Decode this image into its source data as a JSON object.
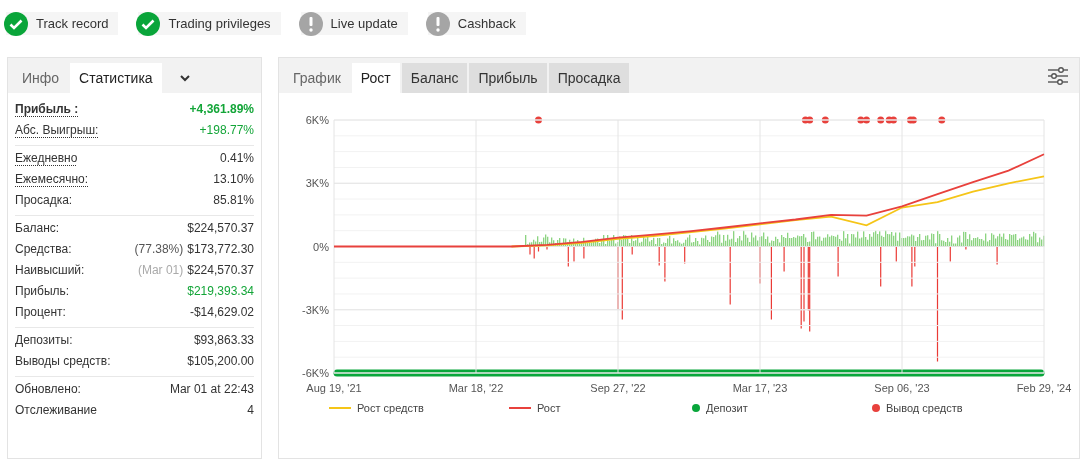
{
  "badges": [
    {
      "label": "Track record",
      "kind": "ok"
    },
    {
      "label": "Trading privileges",
      "kind": "ok"
    },
    {
      "label": "Live update",
      "kind": "warn"
    },
    {
      "label": "Cashback",
      "kind": "warn"
    }
  ],
  "stats_panel": {
    "tabs": [
      {
        "label": "Инфо",
        "selected": false
      },
      {
        "label": "Статистика",
        "selected": true
      }
    ],
    "groups": [
      [
        {
          "label": "Прибыль :",
          "value": "+4,361.89%",
          "positive": true,
          "dotted": true,
          "emphasis": true
        },
        {
          "label": "Абс. Выигрыш:",
          "value": "+198.77%",
          "positive": true,
          "dotted": true,
          "emphasis": false
        }
      ],
      [
        {
          "label": "Ежедневно",
          "value": "0.41%",
          "positive": false,
          "dotted": true,
          "emphasis": false
        },
        {
          "label": "Ежемесячно:",
          "value": "13.10%",
          "positive": false,
          "dotted": true,
          "emphasis": false
        },
        {
          "label": "Просадка:",
          "value": "85.81%",
          "positive": false,
          "dotted": false,
          "emphasis": false
        }
      ],
      [
        {
          "label": "Баланс:",
          "value": "$224,570.37",
          "positive": false,
          "dotted": false,
          "emphasis": false
        },
        {
          "label": "Средства:",
          "note": "(77.38%)",
          "faded": false,
          "value": "$173,772.30",
          "positive": false,
          "dotted": false,
          "emphasis": false
        },
        {
          "label": "Наивысший:",
          "note": "(Mar 01)",
          "faded": true,
          "value": "$224,570.37",
          "positive": false,
          "dotted": false,
          "emphasis": false
        },
        {
          "label": "Прибыль:",
          "value": "$219,393.34",
          "positive": true,
          "dotted": false,
          "emphasis": false
        },
        {
          "label": "Процент:",
          "value": "-$14,629.02",
          "positive": false,
          "dotted": false,
          "emphasis": false
        }
      ],
      [
        {
          "label": "Депозиты:",
          "value": "$93,863.33",
          "positive": false,
          "dotted": false,
          "emphasis": false
        },
        {
          "label": "Выводы средств:",
          "value": "$105,200.00",
          "positive": false,
          "dotted": false,
          "emphasis": false
        }
      ],
      [
        {
          "label": "Обновлено:",
          "value": "Mar 01 at 22:43",
          "positive": false,
          "dotted": false,
          "emphasis": false
        },
        {
          "label": "Отслеживание",
          "value": "4",
          "positive": false,
          "dotted": false,
          "emphasis": false
        }
      ]
    ]
  },
  "chart_panel": {
    "tabs": [
      {
        "label": "График",
        "selected": false,
        "kind": "plain"
      },
      {
        "label": "Рост",
        "selected": true,
        "kind": "plain"
      },
      {
        "label": "Баланс",
        "selected": false,
        "kind": "filled"
      },
      {
        "label": "Прибыль",
        "selected": false,
        "kind": "filled"
      },
      {
        "label": "Просадка",
        "selected": false,
        "kind": "filled"
      }
    ],
    "chart_data": {
      "type": "line",
      "categories": [
        "Aug 19, '21",
        null,
        null,
        null,
        "Mar 18, '22",
        null,
        null,
        null,
        "Sep 27, '22",
        null,
        null,
        null,
        "Mar 17, '23",
        null,
        null,
        null,
        "Sep 06, '23",
        null,
        null,
        null,
        "Feb 29, '24"
      ],
      "series": [
        {
          "name": "Рост средств",
          "color": "#f5c518",
          "values": [
            null,
            null,
            null,
            null,
            null,
            0,
            50,
            170,
            360,
            500,
            670,
            850,
            1050,
            1250,
            1420,
            1000,
            1850,
            2100,
            2600,
            3000,
            3330
          ]
        },
        {
          "name": "Рост",
          "color": "#e8413c",
          "values": [
            0,
            0,
            0,
            0,
            0,
            0,
            80,
            220,
            420,
            560,
            720,
            900,
            1100,
            1280,
            1500,
            1460,
            1900,
            2480,
            3050,
            3600,
            4380
          ]
        }
      ],
      "ylim": [
        -6000,
        6000
      ],
      "grid": true,
      "yticks": [
        {
          "value": 6000,
          "label": "6K%"
        },
        {
          "value": 3000,
          "label": "3K%"
        },
        {
          "value": 0,
          "label": "0%"
        },
        {
          "value": -3000,
          "label": "-3K%"
        },
        {
          "value": -6000,
          "label": "-6K%"
        }
      ]
    },
    "legend": [
      {
        "kind": "line",
        "color": "#f5c518"
      },
      {
        "kind": "line",
        "color": "#e8413c"
      },
      {
        "label": "Депозит",
        "kind": "dot",
        "color": "#09a63b"
      },
      {
        "label": "Вывод средств",
        "kind": "dot",
        "color": "#e8413c"
      }
    ]
  }
}
